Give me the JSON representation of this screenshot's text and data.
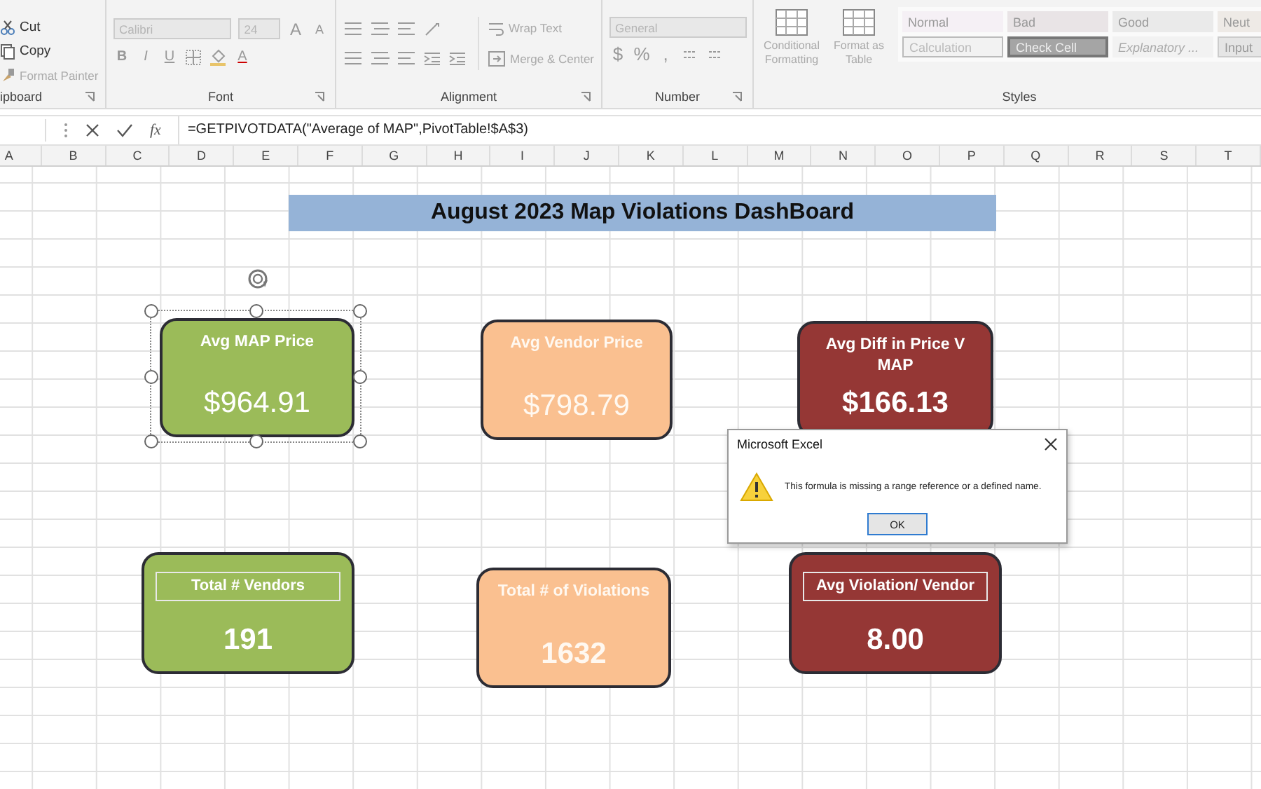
{
  "ribbon": {
    "groups": [
      {
        "kind": "clipboard",
        "label": "ipboard",
        "items": [
          "Cut",
          "Copy",
          "Format Painter"
        ]
      },
      {
        "kind": "font",
        "label": "Font",
        "font_name": "Calibri",
        "font_size": "24",
        "grow": "A",
        "shrink": "A",
        "styles": [
          "B",
          "I",
          "U"
        ],
        "font_color": "A"
      },
      {
        "kind": "alignment",
        "label": "Alignment",
        "wrap": "Wrap Text",
        "merge": "Merge & Center"
      },
      {
        "kind": "number",
        "label": "Number",
        "format": "General",
        "symbols": [
          "$",
          "%",
          ","
        ]
      },
      {
        "kind": "styles",
        "label": "Styles",
        "commands": [
          "Conditional Formatting",
          "Format as Table"
        ],
        "cells": [
          {
            "kind": "normal",
            "label": "Normal"
          },
          {
            "kind": "bad",
            "label": "Bad"
          },
          {
            "kind": "good",
            "label": "Good"
          },
          {
            "kind": "neutral",
            "label": "Neut"
          },
          {
            "kind": "calculation",
            "label": "Calculation"
          },
          {
            "kind": "check",
            "label": "Check Cell"
          },
          {
            "kind": "explanatory",
            "label": "Explanatory ..."
          },
          {
            "kind": "input",
            "label": "Input"
          }
        ]
      }
    ]
  },
  "formula_bar": {
    "fx": "fx",
    "formula": "=GETPIVOTDATA(\"Average of MAP\",PivotTable!$A$3)"
  },
  "columns": [
    "A",
    "B",
    "C",
    "D",
    "E",
    "F",
    "G",
    "H",
    "I",
    "J",
    "K",
    "L",
    "M",
    "N",
    "O",
    "P",
    "Q",
    "R",
    "S",
    "T"
  ],
  "dashboard": {
    "title": "August 2023 Map Violations DashBoard",
    "cards": [
      {
        "title": "Avg MAP Price",
        "value": "$964.91",
        "color": "#9bbb59",
        "value_bold": false,
        "title_boxed": false,
        "selected": true
      },
      {
        "title": "Avg Vendor Price",
        "value": "$798.79",
        "color": "#fac090",
        "value_bold": false,
        "title_boxed": false,
        "selected": false
      },
      {
        "title": "Avg Diff in Price V MAP",
        "value": "$166.13",
        "color": "#953735",
        "value_bold": true,
        "title_boxed": false,
        "selected": false
      },
      {
        "title": "Total # Vendors",
        "value": "191",
        "color": "#9bbb59",
        "value_bold": true,
        "title_boxed": true,
        "selected": false
      },
      {
        "title": "Total # of Violations",
        "value": "1632",
        "color": "#fac090",
        "value_bold": true,
        "title_boxed": false,
        "selected": false
      },
      {
        "title": "Avg Violation/ Vendor",
        "value": "8.00",
        "color": "#953735",
        "value_bold": true,
        "title_boxed": true,
        "selected": false
      }
    ]
  },
  "dialog": {
    "title": "Microsoft Excel",
    "message": "This formula is missing a range reference or a defined name.",
    "button": "OK"
  }
}
